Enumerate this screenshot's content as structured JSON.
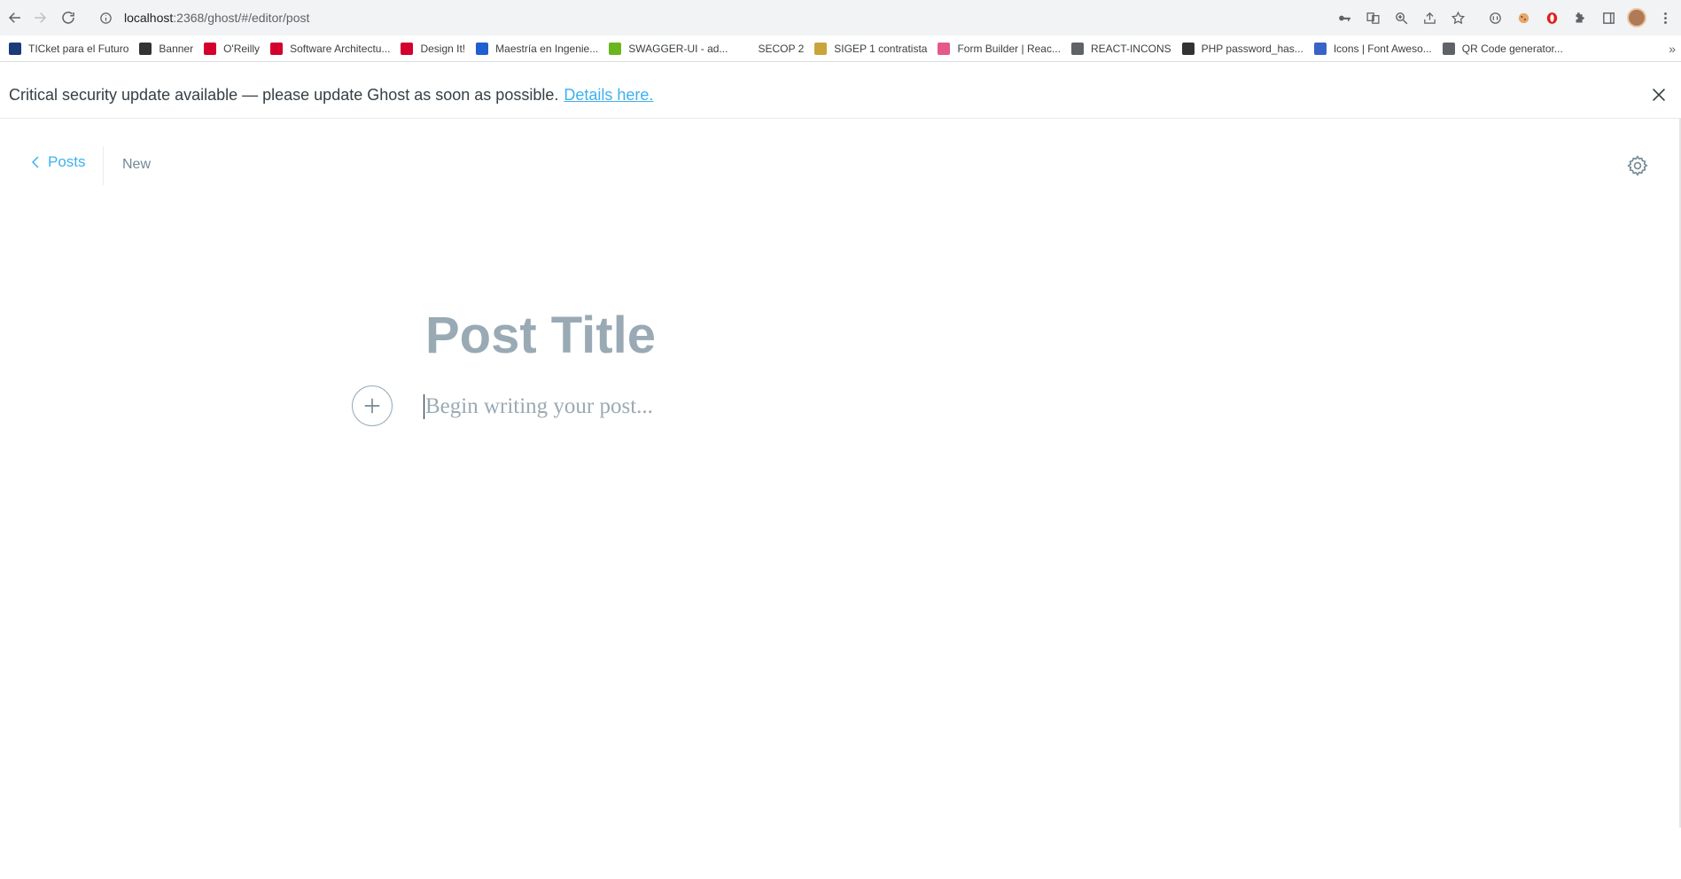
{
  "browser": {
    "url_host": "localhost",
    "url_path": ":2368/ghost/#/editor/post",
    "bookmarks": [
      {
        "label": "TICket para el Futuro",
        "color": "#1a3a7a"
      },
      {
        "label": "Banner",
        "color": "#333333"
      },
      {
        "label": "O'Reilly",
        "color": "#d3002d"
      },
      {
        "label": "Software Architectu...",
        "color": "#d3002d"
      },
      {
        "label": "Design It!",
        "color": "#d3002d"
      },
      {
        "label": "Maestría en Ingenie...",
        "color": "#1f5fd0"
      },
      {
        "label": "SWAGGER-UI - ad...",
        "color": "#6bb51f"
      },
      {
        "label": "SECOP 2",
        "color": "#ffffff"
      },
      {
        "label": "SIGEP 1 contratista",
        "color": "#c9a43a"
      },
      {
        "label": "Form Builder | Reac...",
        "color": "#e6578c"
      },
      {
        "label": "REACT-INCONS",
        "color": "#5f6368"
      },
      {
        "label": "PHP password_has...",
        "color": "#333333"
      },
      {
        "label": "Icons | Font Aweso...",
        "color": "#3a63c7"
      },
      {
        "label": "QR Code generator...",
        "color": "#5f6368"
      }
    ],
    "more": "»"
  },
  "alert": {
    "text": "Critical security update available — please update Ghost as soon as possible.",
    "link": "Details here."
  },
  "editor": {
    "back_label": "Posts",
    "status": "New",
    "title_placeholder": "Post Title",
    "body_placeholder": "Begin writing your post..."
  },
  "colors": {
    "accent": "#3eb0ef",
    "muted": "#738a94",
    "placeholder": "#9aaab4"
  }
}
